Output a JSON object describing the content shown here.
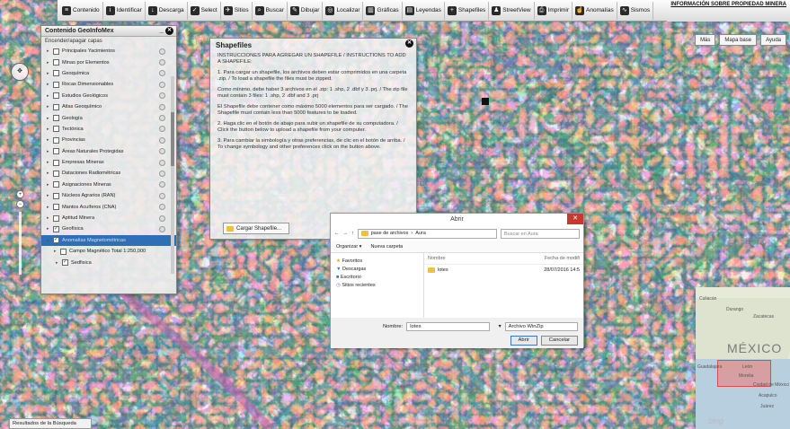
{
  "colors": {
    "toolbar_bg": "#e6e6e6",
    "selected_row": "#2f6fb5",
    "close_button": "#c43a31",
    "map_base": "#7a8c6a"
  },
  "toolbar": {
    "items": [
      {
        "label": "Contenido",
        "icon": "list-icon"
      },
      {
        "label": "Identificar",
        "icon": "info-icon"
      },
      {
        "label": "Descarga",
        "icon": "download-icon"
      },
      {
        "label": "Select",
        "icon": "checkbox-icon"
      },
      {
        "label": "Sitios",
        "icon": "pin-icon"
      },
      {
        "label": "Buscar",
        "icon": "search-icon"
      },
      {
        "label": "Dibujar",
        "icon": "pencil-icon"
      },
      {
        "label": "Localizar",
        "icon": "target-icon"
      },
      {
        "label": "Gráficas",
        "icon": "chart-icon"
      },
      {
        "label": "Leyendas",
        "icon": "legend-icon"
      },
      {
        "label": "Shapefiles",
        "icon": "plus-circle-icon"
      },
      {
        "label": "StreetView",
        "icon": "person-icon"
      },
      {
        "label": "Imprimir",
        "icon": "printer-icon"
      },
      {
        "label": "Anomalías",
        "icon": "hand-icon"
      },
      {
        "label": "Sismos",
        "icon": "quake-icon"
      }
    ],
    "info_link": "INFORMACIÓN SOBRE PROPIEDAD MINERA"
  },
  "map_buttons": {
    "more": "Más",
    "basemap": "Mapa base",
    "help": "Ayuda"
  },
  "contents_panel": {
    "title": "Contenido GeoInfoMex",
    "subtitle": "Encender/apagar capas",
    "layers": [
      {
        "label": "Principales Yacimientos",
        "checked": false,
        "kind": "normal"
      },
      {
        "label": "Minas por Elementos",
        "checked": false,
        "kind": "normal"
      },
      {
        "label": "Geoquímica",
        "checked": false,
        "kind": "normal"
      },
      {
        "label": "Rocas Dimensionables",
        "checked": false,
        "kind": "normal"
      },
      {
        "label": "Estudios Geológicos",
        "checked": false,
        "kind": "normal"
      },
      {
        "label": "Atlas Geoquímico",
        "checked": false,
        "kind": "normal"
      },
      {
        "label": "Geología",
        "checked": false,
        "kind": "normal"
      },
      {
        "label": "Tectónica",
        "checked": false,
        "kind": "normal"
      },
      {
        "label": "Provincias",
        "checked": false,
        "kind": "normal"
      },
      {
        "label": "Áreas Naturales Protegidas",
        "checked": false,
        "kind": "normal"
      },
      {
        "label": "Empresas Mineras",
        "checked": false,
        "kind": "normal"
      },
      {
        "label": "Dataciones Radiométricas",
        "checked": false,
        "kind": "normal"
      },
      {
        "label": "Asignaciones Mineras",
        "checked": false,
        "kind": "normal"
      },
      {
        "label": "Núcleos Agrarios (RAN)",
        "checked": false,
        "kind": "normal"
      },
      {
        "label": "Mantos Acuíferos (CNA)",
        "checked": false,
        "kind": "normal"
      },
      {
        "label": "Aptitud Minera",
        "checked": false,
        "kind": "normal"
      },
      {
        "label": "Geofísica",
        "checked": true,
        "kind": "normal"
      },
      {
        "label": "Anomalías Magnetométricas",
        "checked": true,
        "kind": "selected"
      },
      {
        "label": "Campo Magnético Total 1:250,000",
        "checked": false,
        "kind": "sub"
      },
      {
        "label": "Sedfisica",
        "checked": true,
        "kind": "sub2"
      }
    ]
  },
  "shapefiles_panel": {
    "title": "Shapefiles",
    "paragraphs": [
      "INSTRUCCIONES PARA AGREGAR UN SHAPEFILE / INSTRUCTIONS TO ADD A SHAPEFILE:",
      "1. Para cargar un shapefile, los archivos deben estar comprimidos en una carpeta .zip. / To load a shapefile the files must be zipped.",
      "Como mínimo, debe haber 3 archivos en el .zip: 1 .shp, 2 .dbf y 3 .prj. / The zip file must contain 3 files: 1 .shp, 2 .dbf and 3 .prj",
      "El Shapefile debe contener como máximo 5000 elementos para ser cargado. / The Shapefile must contain less than 5000 features to be loaded.",
      "2. Haga clic en el botón de abajo para subir un shapefile de su computadora. / Click the button below to upload a shapefile from your computer.",
      "3. Para cambiar la simbología y otras preferencias, de clic en el botón de arriba. / To change symbology and other preferences click on the button above."
    ],
    "load_button": "Cargar Shapefile..."
  },
  "open_dialog": {
    "title": "Abrir",
    "path": [
      "pase de archivos",
      "Aura"
    ],
    "search_placeholder": "Buscar en Aura",
    "organize": "Organizar ▾",
    "new_folder": "Nueva carpeta",
    "sidebar": [
      {
        "label": "Favoritos",
        "icon": "star-icon"
      },
      {
        "label": "Descargas",
        "icon": "download-folder-icon"
      },
      {
        "label": "Escritorio",
        "icon": "desktop-icon"
      },
      {
        "label": "Sitios recientes",
        "icon": "recent-icon"
      }
    ],
    "columns": {
      "name": "Nombre",
      "date": "Fecha de modifi"
    },
    "files": [
      {
        "name": "lotes",
        "date": "28/07/2016 14:5"
      }
    ],
    "file_name_label": "Nombre:",
    "file_name_value": "lotes",
    "file_type": "Archivo WinZip",
    "open_button": "Abrir",
    "cancel_button": "Cancelar"
  },
  "locator_map": {
    "big_label": "MÉXICO",
    "places": [
      "Culiacán",
      "Durango",
      "Zacatecas",
      "Guadalajara",
      "León",
      "Morelia",
      "Ciudad de México",
      "Acapulco",
      "Juárez"
    ]
  },
  "status_bar": "Resultados de la Búsqueda",
  "bing_logo": "bing"
}
